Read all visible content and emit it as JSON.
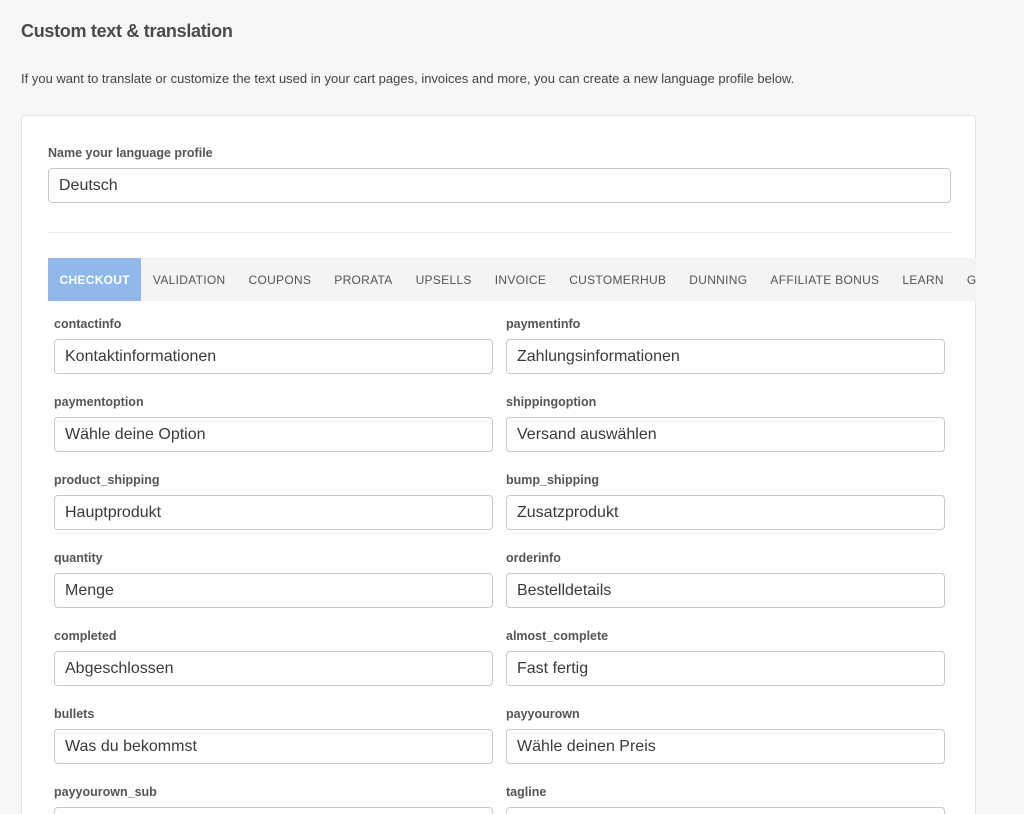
{
  "header": {
    "title": "Custom text & translation",
    "description": "If you want to translate or customize the text used in your cart pages, invoices and more, you can create a new language profile below."
  },
  "profile": {
    "label": "Name your language profile",
    "value": "Deutsch"
  },
  "tabs": [
    {
      "label": "CHECKOUT",
      "active": true
    },
    {
      "label": "VALIDATION",
      "active": false
    },
    {
      "label": "COUPONS",
      "active": false
    },
    {
      "label": "PRORATA",
      "active": false
    },
    {
      "label": "UPSELLS",
      "active": false
    },
    {
      "label": "INVOICE",
      "active": false
    },
    {
      "label": "CUSTOMERHUB",
      "active": false
    },
    {
      "label": "DUNNING",
      "active": false
    },
    {
      "label": "AFFILIATE BONUS",
      "active": false
    },
    {
      "label": "LEARN",
      "active": false
    },
    {
      "label": "GENERAL",
      "active": false
    }
  ],
  "fields": [
    {
      "label": "contactinfo",
      "value": "Kontaktinformationen"
    },
    {
      "label": "paymentinfo",
      "value": "Zahlungsinformationen"
    },
    {
      "label": "paymentoption",
      "value": "Wähle deine Option"
    },
    {
      "label": "shippingoption",
      "value": "Versand auswählen"
    },
    {
      "label": "product_shipping",
      "value": "Hauptprodukt"
    },
    {
      "label": "bump_shipping",
      "value": "Zusatzprodukt"
    },
    {
      "label": "quantity",
      "value": "Menge"
    },
    {
      "label": "orderinfo",
      "value": "Bestelldetails"
    },
    {
      "label": "completed",
      "value": "Abgeschlossen"
    },
    {
      "label": "almost_complete",
      "value": "Fast fertig"
    },
    {
      "label": "bullets",
      "value": "Was du bekommst"
    },
    {
      "label": "payyourown",
      "value": "Wähle deinen Preis"
    },
    {
      "label": "payyourown_sub",
      "value": ""
    },
    {
      "label": "tagline",
      "value": ""
    }
  ],
  "colors": {
    "active_tab": "#90b8ea",
    "tab_bar": "#f3f4f6",
    "page_bg": "#f7f7f7"
  }
}
